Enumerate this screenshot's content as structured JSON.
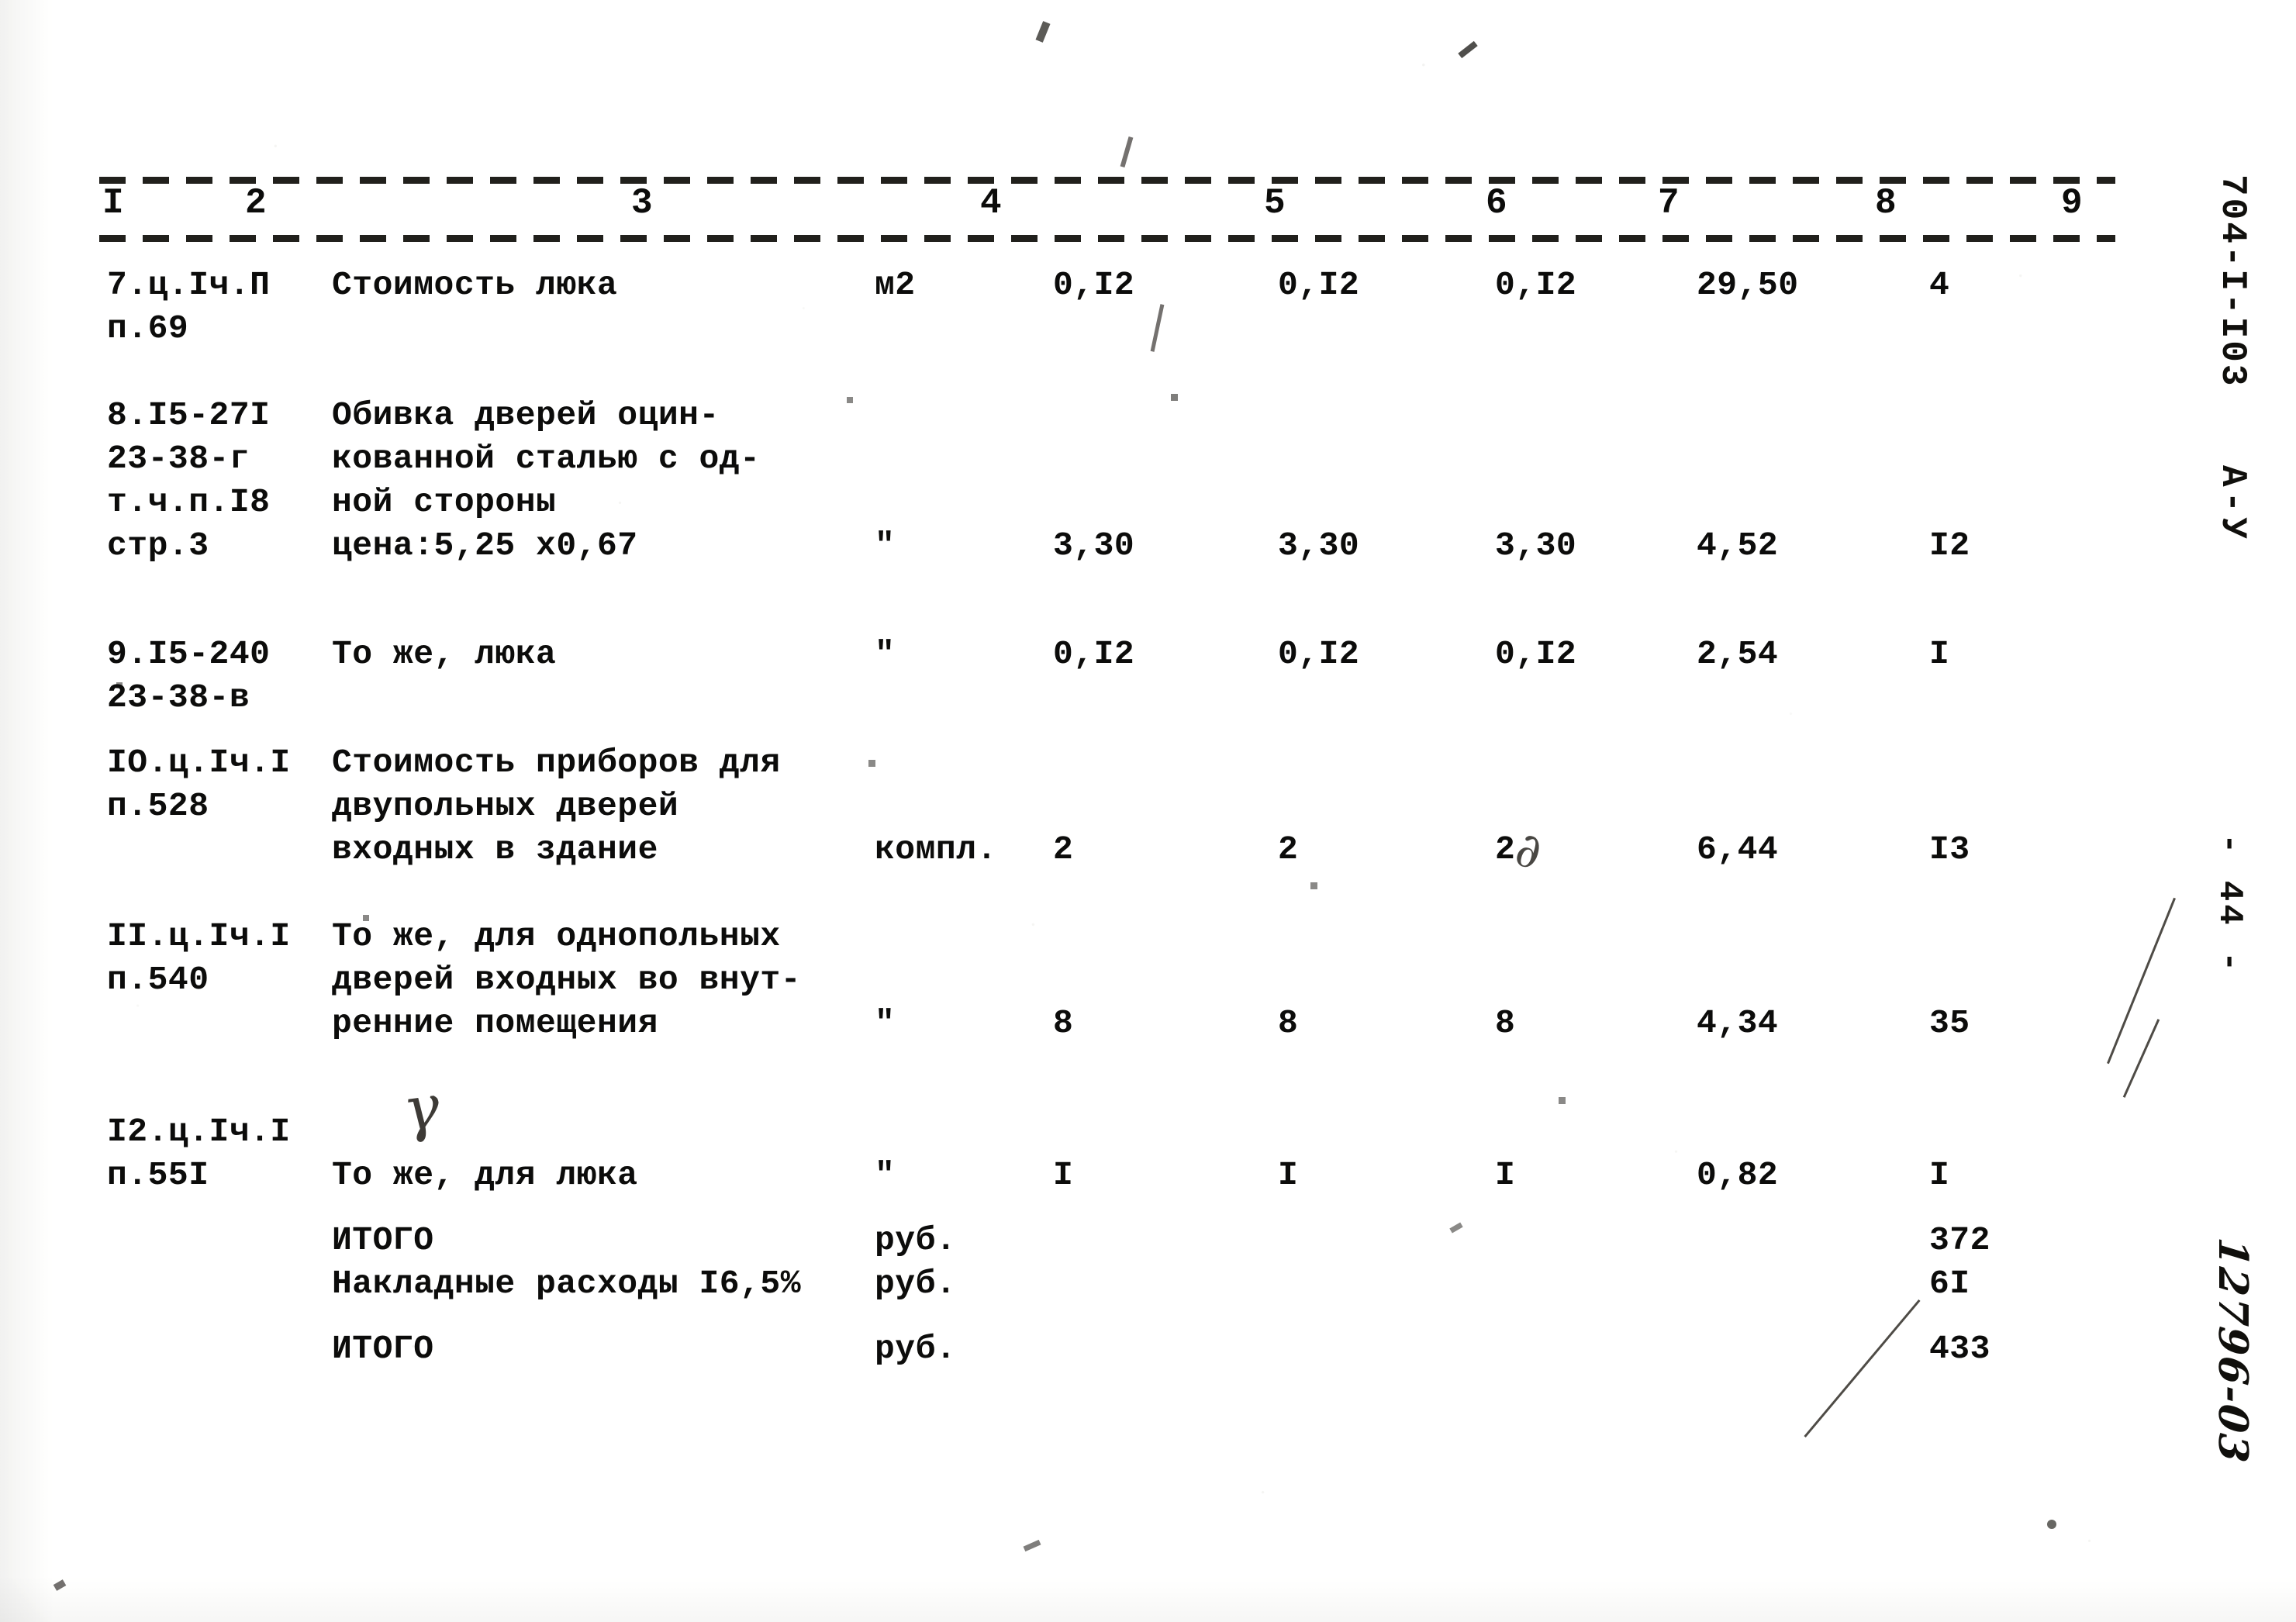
{
  "document": {
    "column_headers": [
      "I",
      "2",
      "3",
      "4",
      "5",
      "6",
      "7",
      "8",
      "9"
    ],
    "margin": {
      "id_stamp": "704-I-I03",
      "id_sub": "А-У",
      "page_number": "- 44 -",
      "handwritten_code": "12796-03"
    },
    "rows": [
      {
        "code": "7.ц.Iч.П\nп.69",
        "description": "Стоимость люка",
        "unit": "м2",
        "v5": "0,I2",
        "v6": "0,I2",
        "v7": "0,I2",
        "v8": "29,50",
        "v9": "4"
      },
      {
        "code": "8.I5-27I\n  23-38-г\n  т.ч.п.I8\n    стр.3",
        "description": "Обивка дверей оцин-\nкованной сталью с од-\nной стороны\nцена:5,25 х0,67",
        "unit": "\"",
        "v5": "3,30",
        "v6": "3,30",
        "v7": "3,30",
        "v8": "4,52",
        "v9": "I2"
      },
      {
        "code": "9.I5-240\n 23-38-в",
        "description": "То же, люка",
        "unit": "\"",
        "v5": "0,I2",
        "v6": "0,I2",
        "v7": "0,I2",
        "v8": "2,54",
        "v9": "I"
      },
      {
        "code": "IO.ц.Iч.I\n   п.528",
        "description": "Стоимость приборов для\nдвупольных дверей\nвходных в здание",
        "unit": "компл.",
        "v5": "2",
        "v6": "2",
        "v7": "2",
        "v8": "6,44",
        "v9": "I3"
      },
      {
        "code": "II.ц.Iч.I\n   п.540",
        "description": "То же, для однопольных\nдверей входных во внут-\nренние помещения",
        "unit": "\"",
        "v5": "8",
        "v6": "8",
        "v7": "8",
        "v8": "4,34",
        "v9": "35"
      },
      {
        "code": "I2.ц.Iч.I\n   п.55I",
        "description": "То же, для люка",
        "unit": "\"",
        "v5": "I",
        "v6": "I",
        "v7": "I",
        "v8": "0,82",
        "v9": "I"
      }
    ],
    "summary": [
      {
        "label": "ИТОГО",
        "unit": "руб.",
        "total": "372"
      },
      {
        "label": "Накладные расходы I6,5%",
        "unit": "руб.",
        "total": "6I"
      },
      {
        "label": "ИТОГО",
        "unit": "руб.",
        "total": "433"
      }
    ]
  }
}
